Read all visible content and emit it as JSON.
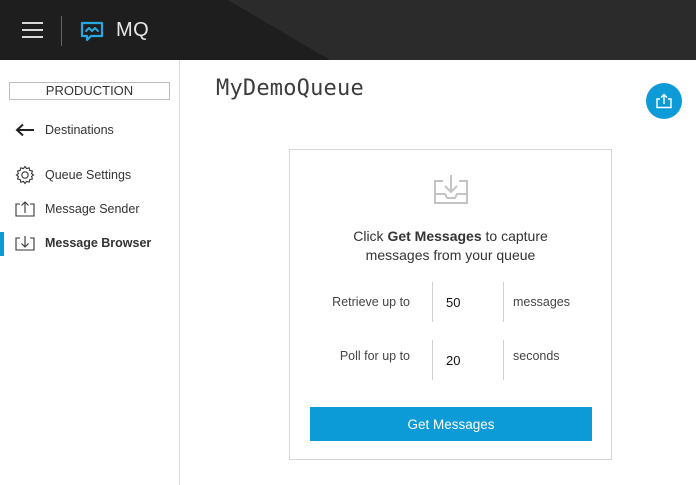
{
  "header": {
    "app_name": "MQ",
    "menu_icon": "hamburger-icon",
    "logo_icon": "mq-logo-icon",
    "background": "#2b2b2b"
  },
  "sidebar": {
    "environment": "PRODUCTION",
    "back_link": {
      "label": "Destinations",
      "icon": "arrow-left-icon"
    },
    "items": [
      {
        "label": "Queue Settings",
        "icon": "gear-icon",
        "active": false
      },
      {
        "label": "Message Sender",
        "icon": "upload-tray-icon",
        "active": false
      },
      {
        "label": "Message Browser",
        "icon": "download-tray-icon",
        "active": true
      }
    ]
  },
  "main": {
    "title": "MyDemoQueue",
    "fab_icon": "export-icon",
    "accent": "#0d9bd8",
    "card": {
      "icon": "download-tray-icon",
      "prompt_prefix": "Click ",
      "prompt_bold": "Get Messages",
      "prompt_suffix": " to capture messages from your queue",
      "retrieve": {
        "label": "Retrieve up to",
        "value": "50",
        "unit": "messages"
      },
      "poll": {
        "label": "Poll for up to",
        "value": "20",
        "unit": "seconds"
      },
      "button_label": "Get Messages"
    }
  }
}
